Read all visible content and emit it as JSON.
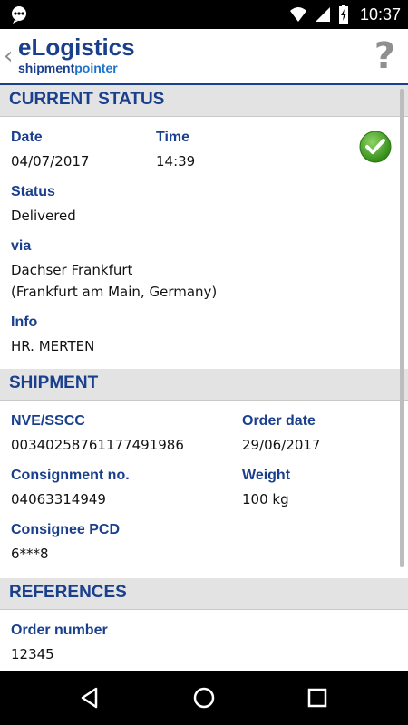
{
  "status_bar": {
    "time": "10:37",
    "icons": [
      "chat-bubble-icon",
      "wifi-icon",
      "signal-icon",
      "battery-charging-icon"
    ]
  },
  "app_bar": {
    "brand_title": "eLogistics",
    "brand_sub_strong": "shipment",
    "brand_sub_light": "pointer",
    "help_label": "?"
  },
  "current_status": {
    "header": "CURRENT STATUS",
    "date_label": "Date",
    "date_value": "04/07/2017",
    "time_label": "Time",
    "time_value": "14:39",
    "status_label": "Status",
    "status_value": "Delivered",
    "via_label": "via",
    "via_line1": "Dachser Frankfurt",
    "via_line2": "(Frankfurt am Main, Germany)",
    "info_label": "Info",
    "info_value": "HR. MERTEN",
    "status_icon": "check-circle-icon",
    "status_icon_color": "#3c9a1e"
  },
  "shipment": {
    "header": "SHIPMENT",
    "nve_label": "NVE/SSCC",
    "nve_value": "00340258761177491986",
    "order_date_label": "Order date",
    "order_date_value": "29/06/2017",
    "consignment_label": "Consignment no.",
    "consignment_value": "04063314949",
    "weight_label": "Weight",
    "weight_value": "100 kg",
    "consignee_label": "Consignee PCD",
    "consignee_value": "6***8"
  },
  "references": {
    "header": "REFERENCES",
    "order_number_label": "Order number",
    "order_number_value": "12345"
  },
  "colors": {
    "accent": "#1a3f8c",
    "section_bg": "#e3e3e3"
  }
}
